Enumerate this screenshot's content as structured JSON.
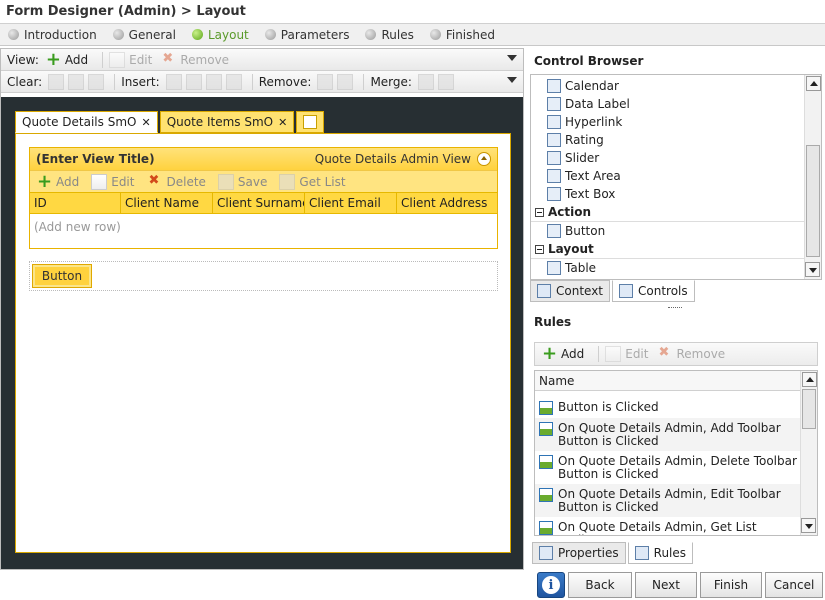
{
  "title": "Form Designer (Admin) > Layout",
  "steps": [
    {
      "label": "Introduction",
      "active": false
    },
    {
      "label": "General",
      "active": false
    },
    {
      "label": "Layout",
      "active": true
    },
    {
      "label": "Parameters",
      "active": false
    },
    {
      "label": "Rules",
      "active": false
    },
    {
      "label": "Finished",
      "active": false
    }
  ],
  "view_toolbar": {
    "label": "View:",
    "add": "Add",
    "edit": "Edit",
    "remove": "Remove"
  },
  "edit_toolbar": {
    "clear": "Clear:",
    "insert": "Insert:",
    "remove": "Remove:",
    "merge": "Merge:"
  },
  "tabs": [
    {
      "label": "Quote Details SmO",
      "active": true
    },
    {
      "label": "Quote Items SmO",
      "active": false
    }
  ],
  "view": {
    "title": "(Enter View Title)",
    "subtitle": "Quote Details Admin View",
    "toolbar": [
      "Add",
      "Edit",
      "Delete",
      "Save",
      "Get List"
    ],
    "columns": [
      "ID",
      "Client Name",
      "Client Surname",
      "Client Email",
      "Client Address"
    ],
    "add_row": "(Add new row)"
  },
  "design_button": "Button",
  "control_browser": {
    "title": "Control Browser",
    "items": [
      {
        "type": "item",
        "label": "Calendar",
        "icon": "calendar-icon"
      },
      {
        "type": "item",
        "label": "Data Label",
        "icon": "data-label-icon"
      },
      {
        "type": "item",
        "label": "Hyperlink",
        "icon": "hyperlink-icon"
      },
      {
        "type": "item",
        "label": "Rating",
        "icon": "rating-icon"
      },
      {
        "type": "item",
        "label": "Slider",
        "icon": "slider-icon"
      },
      {
        "type": "item",
        "label": "Text Area",
        "icon": "text-area-icon"
      },
      {
        "type": "item",
        "label": "Text Box",
        "icon": "text-box-icon"
      },
      {
        "type": "group",
        "label": "Action"
      },
      {
        "type": "item",
        "label": "Button",
        "icon": "button-icon"
      },
      {
        "type": "group",
        "label": "Layout"
      },
      {
        "type": "item",
        "label": "Table",
        "icon": "table-icon"
      }
    ],
    "tabs": [
      "Context",
      "Controls"
    ]
  },
  "rules": {
    "title": "Rules",
    "toolbar": {
      "add": "Add",
      "edit": "Edit",
      "remove": "Remove"
    },
    "column": "Name",
    "items": [
      "Button is Clicked",
      "On Quote Details Admin, Add Toolbar Button is Clicked",
      "On Quote Details Admin, Delete Toolbar Button is Clicked",
      "On Quote Details Admin, Edit Toolbar Button is Clicked",
      "On Quote Details Admin, Get List Toolbar"
    ],
    "tabs": [
      "Properties",
      "Rules"
    ]
  },
  "footer": {
    "back": "Back",
    "next": "Next",
    "finish": "Finish",
    "cancel": "Cancel"
  }
}
